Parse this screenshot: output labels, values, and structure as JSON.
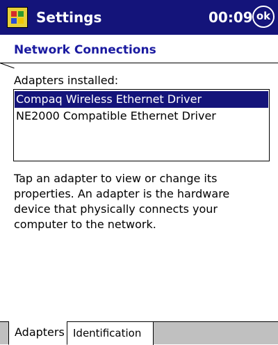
{
  "titlebar": {
    "app_title": "Settings",
    "clock": "00:09",
    "ok_label": "ok"
  },
  "page": {
    "heading": "Network Connections",
    "adapters_label": "Adapters installed:",
    "adapters": [
      {
        "label": "Compaq Wireless Ethernet Driver",
        "selected": true
      },
      {
        "label": "NE2000 Compatible Ethernet Driver",
        "selected": false
      }
    ],
    "description": "Tap an adapter to view or change its properties. An adapter is the hardware device that physically connects your computer to the network."
  },
  "tabs": [
    {
      "label": "Adapters",
      "active": true
    },
    {
      "label": "Identification",
      "active": false
    }
  ],
  "colors": {
    "titlebar": "#14147a",
    "heading": "#1a1aa0",
    "selection": "#14147a",
    "tab_strip": "#c0c0c0"
  }
}
